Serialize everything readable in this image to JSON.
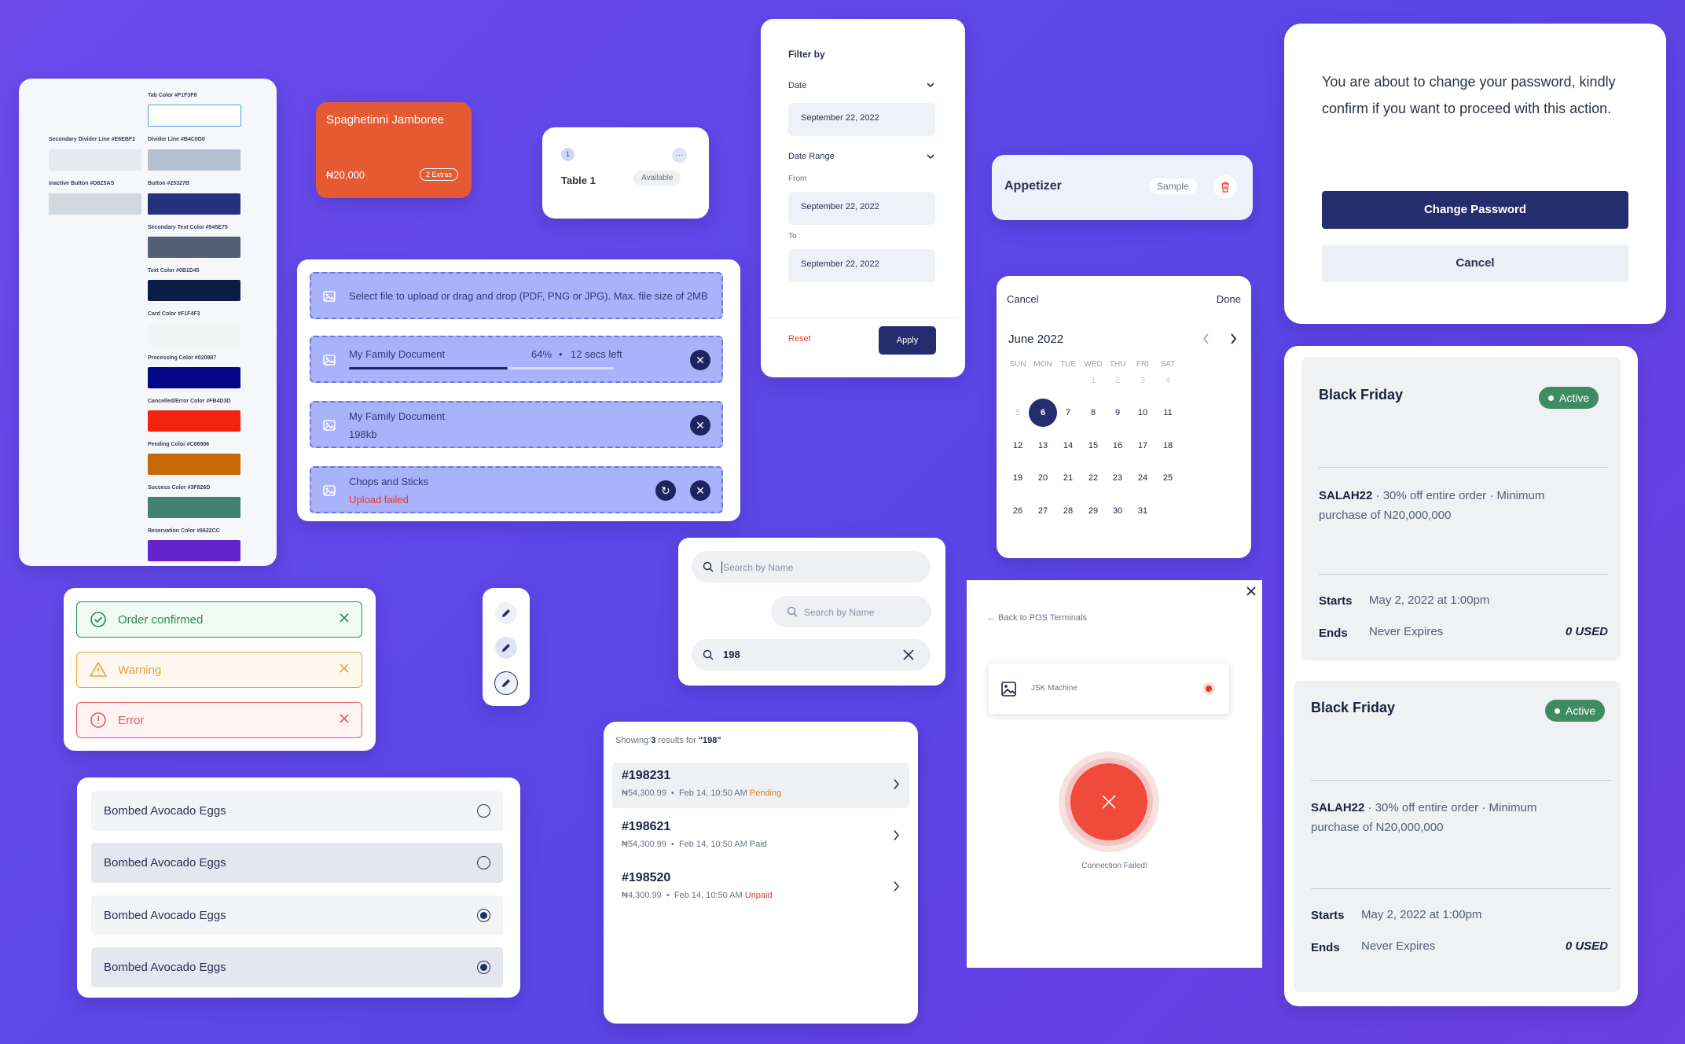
{
  "palette": {
    "items": [
      {
        "label": "Tab Color #F1F3F8",
        "color": "#FFFFFF"
      },
      {
        "label": "Secondary Divider Line #E6EBF2",
        "color": "#E6EBF2"
      },
      {
        "label": "Divider Line #B4C0D0",
        "color": "#B4C0D0"
      },
      {
        "label": "Inactive Button #D8Z5AS",
        "color": "#D2D8E0"
      },
      {
        "label": "Button #25327B",
        "color": "#25327B"
      },
      {
        "label": "Secondary Text Color #545E75",
        "color": "#545E75"
      },
      {
        "label": "Text Color #0B1D45",
        "color": "#0B1D45"
      },
      {
        "label": "Card Color #F1F4F3",
        "color": "#F1F4F3"
      },
      {
        "label": "Processing Color #020887",
        "color": "#020887"
      },
      {
        "label": "Cancelled/Error Color #FB4D3D",
        "color": "#F22411"
      },
      {
        "label": "Pending Color #C66906",
        "color": "#C66906"
      },
      {
        "label": "Success Color #3F826D",
        "color": "#3F826D"
      },
      {
        "label": "Reservation Color #6622CC",
        "color": "#6622CC"
      }
    ]
  },
  "menu_card": {
    "name": "Spaghetinni Jamboree",
    "price": "₦20,000",
    "extras": "2 Extras",
    "color": "#E55A32"
  },
  "table_card": {
    "badge": "1",
    "name": "Table 1",
    "status": "Available"
  },
  "upload": {
    "prompt": "Select file to upload or drag and drop (PDF, PNG or JPG). Max. file size of 2MB",
    "progress_file": "My Family Document",
    "progress_percent": "64%",
    "progress_sep": "•",
    "progress_time": "12 secs left",
    "progress_value": 0.6,
    "done_file": "My Family Document",
    "done_size": "198kb",
    "failed_file": "Chops and Sticks",
    "failed_text": "Upload failed"
  },
  "filter": {
    "title": "Filter by",
    "date_label": "Date",
    "date_value": "September 22, 2022",
    "range_label": "Date Range",
    "from_label": "From",
    "from_value": "September 22, 2022",
    "to_label": "To",
    "to_value": "September 22, 2022",
    "reset": "Reset",
    "apply": "Apply"
  },
  "appetizer": {
    "name": "Appetizer",
    "tag": "Sample"
  },
  "password": {
    "message": "You are about to change your password, kindly confirm if you want to proceed with this action.",
    "primary": "Change Password",
    "secondary": "Cancel"
  },
  "calendar": {
    "cancel": "Cancel",
    "done": "Done",
    "month": "June 2022",
    "dow": [
      "SUN",
      "MON",
      "TUE",
      "WED",
      "THU",
      "FRI",
      "SAT"
    ],
    "weeks": [
      [
        "",
        "",
        "",
        "1",
        "2",
        "3",
        "4"
      ],
      [
        "5",
        "6",
        "7",
        "8",
        "9",
        "10",
        "11"
      ],
      [
        "12",
        "13",
        "14",
        "15",
        "16",
        "17",
        "18"
      ],
      [
        "19",
        "20",
        "21",
        "22",
        "23",
        "24",
        "25"
      ],
      [
        "26",
        "27",
        "28",
        "29",
        "30",
        "31",
        ""
      ]
    ],
    "selected": "6"
  },
  "toasts": [
    {
      "text": "Order confirmed",
      "color": "#2f8a5a",
      "bg": "#eefaf3"
    },
    {
      "text": "Warning",
      "color": "#e8a33d",
      "bg": "#fff8ee"
    },
    {
      "text": "Error",
      "color": "#e25c5c",
      "bg": "#fff2f2"
    }
  ],
  "search": {
    "placeholder": "Search by Name",
    "placeholder2": "Search by Name",
    "query": "198"
  },
  "results": {
    "prefix": "Showing",
    "count": "3",
    "mid": "results for",
    "query": "\"198\"",
    "items": [
      {
        "id": "#198231",
        "meta": "₦54,300.99  •  Feb 14, 10:50 AM",
        "status": "Pending",
        "status_color": "#e07f1b"
      },
      {
        "id": "#198621",
        "meta": "₦54,300.99  •  Feb 14, 10:50 AM",
        "status": "Paid",
        "status_color": "#3f826d"
      },
      {
        "id": "#198520",
        "meta": "₦4,300.99  •  Feb 14, 10:50 AM",
        "status": "Unpaid",
        "status_color": "#e53b2a"
      }
    ]
  },
  "options": [
    {
      "label": "Bombed Avocado Eggs",
      "selected": false
    },
    {
      "label": "Bombed Avocado Eggs",
      "selected": false
    },
    {
      "label": "Bombed Avocado Eggs",
      "selected": true
    },
    {
      "label": "Bombed Avocado Eggs",
      "selected": true
    }
  ],
  "pos": {
    "back": "← Back to POS Terminals",
    "machine": "JSK Machine",
    "status": "Connection Failed!"
  },
  "promos": [
    {
      "title": "Black Friday",
      "status": "Active",
      "code": "SALAH22",
      "desc_line1": "·  30% off entire order · Minimum",
      "desc_line2": "purchase of N20,000,000",
      "starts_label": "Starts",
      "starts": "May 2, 2022 at 1:00pm",
      "ends_label": "Ends",
      "ends": "Never Expires",
      "used": "0 USED"
    },
    {
      "title": "Black Friday",
      "status": "Active",
      "code": "SALAH22",
      "desc_line1": "·  30% off entire order · Minimum",
      "desc_line2": "purchase of N20,000,000",
      "starts_label": "Starts",
      "starts": "May 2, 2022 at 1:00pm",
      "ends_label": "Ends",
      "ends": "Never Expires",
      "used": "0 USED"
    }
  ]
}
